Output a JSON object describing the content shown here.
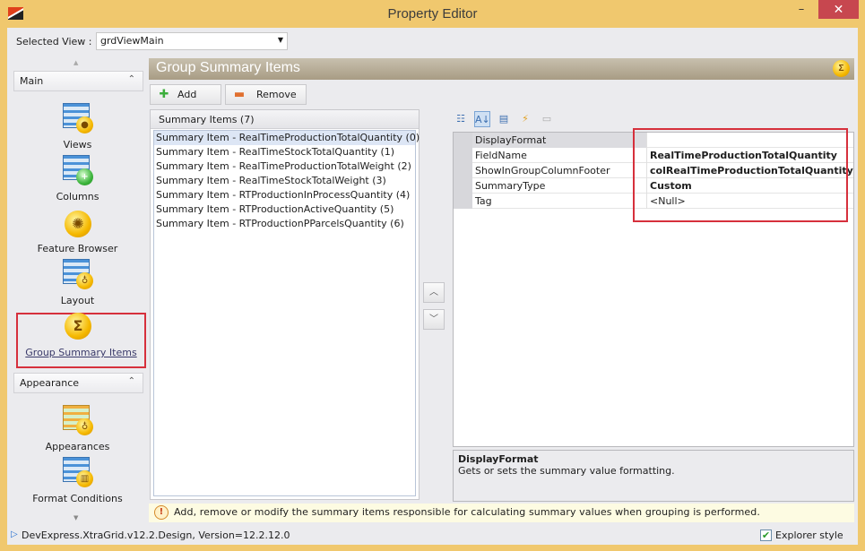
{
  "window": {
    "title": "Property Editor",
    "minimize": "–",
    "maximize": "▭",
    "close": "✕"
  },
  "selected_view": {
    "label": "Selected View :",
    "value": "grdViewMain"
  },
  "nav": {
    "groups": [
      {
        "label": "Main"
      },
      {
        "label": "Appearance"
      }
    ],
    "items": [
      {
        "label": "Views"
      },
      {
        "label": "Columns"
      },
      {
        "label": "Feature Browser"
      },
      {
        "label": "Layout"
      },
      {
        "label": "Group Summary Items",
        "selected": true
      },
      {
        "label": "Appearances"
      },
      {
        "label": "Format Conditions"
      }
    ]
  },
  "header": {
    "title": "Group Summary Items"
  },
  "toolbar": {
    "add_label": "Add",
    "remove_label": "Remove"
  },
  "summary_list": {
    "header": "Summary Items (7)",
    "items": [
      "Summary Item - RealTimeProductionTotalQuantity (0)",
      "Summary Item - RealTimeStockTotalQuantity (1)",
      "Summary Item - RealTimeProductionTotalWeight (2)",
      "Summary Item - RealTimeStockTotalWeight (3)",
      "Summary Item - RTProductionInProcessQuantity (4)",
      "Summary Item - RTProductionActiveQuantity (5)",
      "Summary Item - RTProductionPParcelsQuantity (6)"
    ]
  },
  "property_grid": {
    "rows": [
      {
        "name": "DisplayFormat",
        "value": "",
        "bold": false
      },
      {
        "name": "FieldName",
        "value": "RealTimeProductionTotalQuantity",
        "bold": true
      },
      {
        "name": "ShowInGroupColumnFooter",
        "value": "colRealTimeProductionTotalQuantity",
        "bold": true
      },
      {
        "name": "SummaryType",
        "value": "Custom",
        "bold": true
      },
      {
        "name": "Tag",
        "value": "<Null>",
        "bold": false
      }
    ]
  },
  "description": {
    "title": "DisplayFormat",
    "text": "Gets or sets the summary value formatting."
  },
  "hint": "Add, remove or modify the summary items responsible for calculating summary values when grouping is performed.",
  "status": {
    "text": "DevExpress.XtraGrid.v12.2.Design, Version=12.2.12.0",
    "explorer_style_label": "Explorer style",
    "explorer_style_checked": true
  }
}
